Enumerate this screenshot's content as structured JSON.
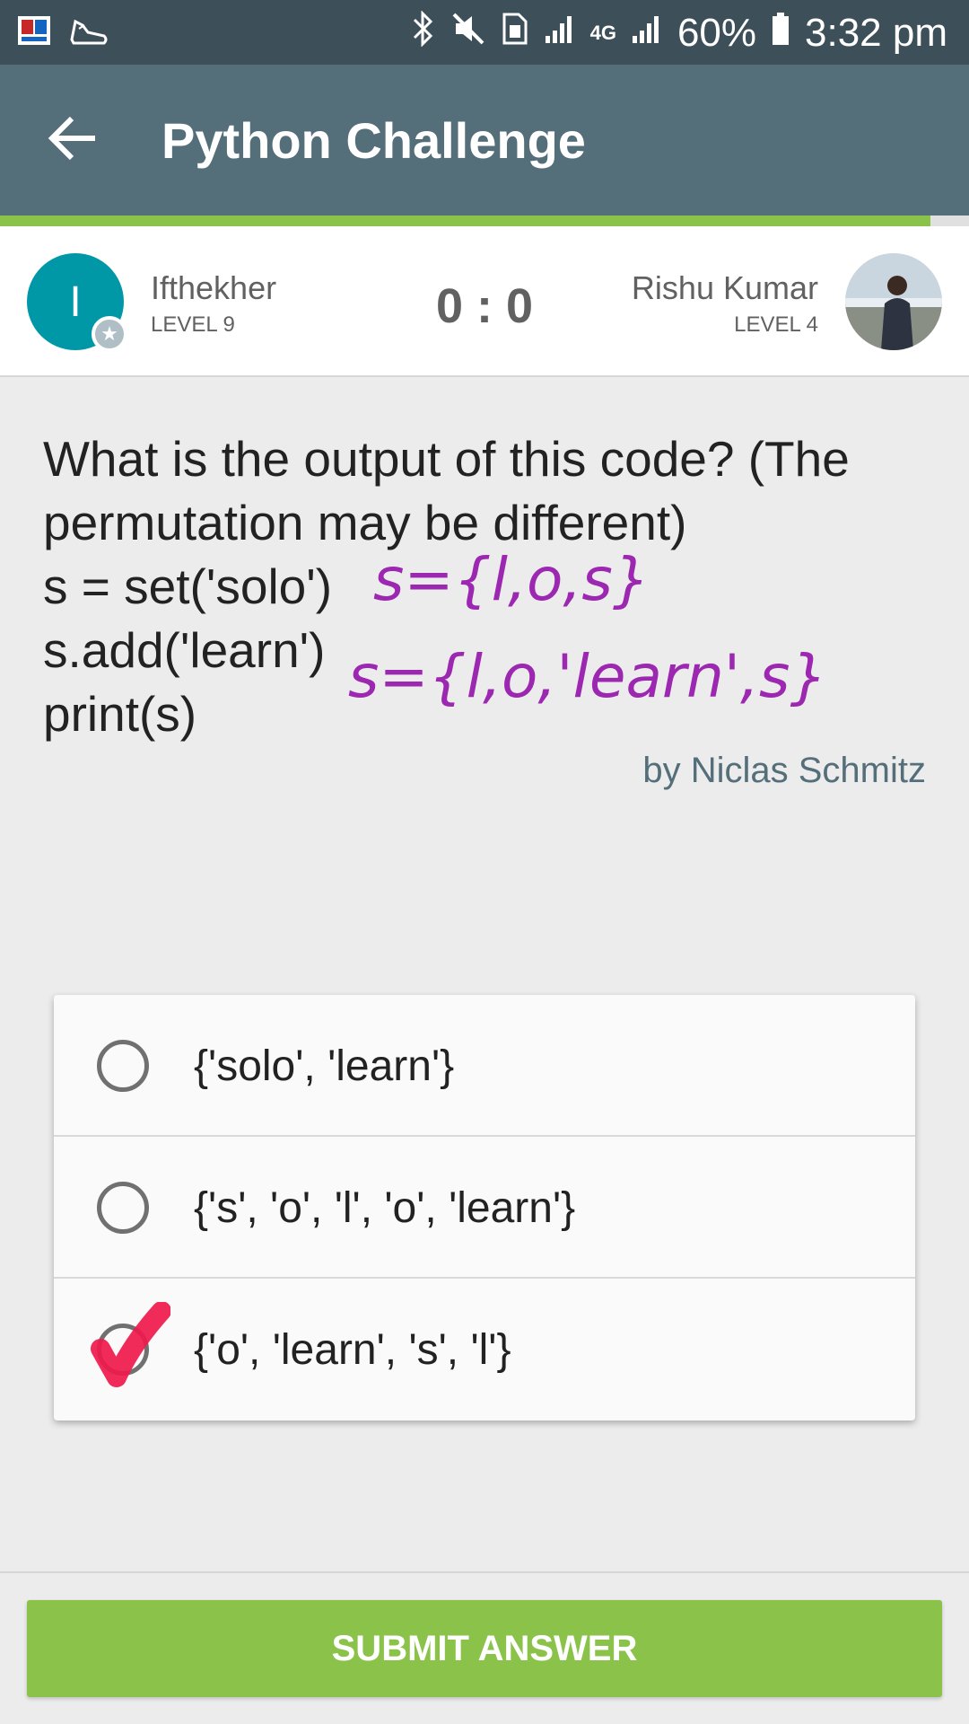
{
  "status_bar": {
    "battery": "60%",
    "time": "3:32 pm",
    "network": "4G",
    "icons": [
      "app-notification-icon",
      "running-shoe-icon",
      "bluetooth-icon",
      "mute-icon",
      "sim-icon",
      "signal-icon",
      "4g-signal-icon",
      "battery-icon"
    ]
  },
  "app_bar": {
    "title": "Python Challenge",
    "back_icon": "back-arrow-icon"
  },
  "progress": {
    "fraction": 0.96,
    "color": "#8bc34a"
  },
  "players": {
    "left": {
      "initial": "I",
      "name": "Ifthekher",
      "level": "LEVEL 9",
      "avatar_color": "#0097a7"
    },
    "score": "0 : 0",
    "right": {
      "name": "Rishu Kumar",
      "level": "LEVEL 4"
    }
  },
  "question": {
    "lines": [
      "What is the output of this code? (The",
      "permutation may be different)",
      "s = set('solo')",
      "s.add('learn')",
      "print(s)"
    ],
    "author": "by Niclas Schmitz"
  },
  "annotations": {
    "line1": "s={l,o,s}",
    "line2": "s={l,o,'learn',s}",
    "color": "#9c27b0"
  },
  "options": [
    {
      "label": "{'solo', 'learn'}",
      "marked": false
    },
    {
      "label": "{'s', 'o', 'l', 'o', 'learn'}",
      "marked": false
    },
    {
      "label": "{'o', 'learn', 's', 'l'}",
      "marked": true
    }
  ],
  "submit": {
    "label": "SUBMIT ANSWER"
  },
  "colors": {
    "status_bar": "#3d4f59",
    "app_bar": "#546e7a",
    "accent": "#8bc34a",
    "author": "#546e7a"
  }
}
